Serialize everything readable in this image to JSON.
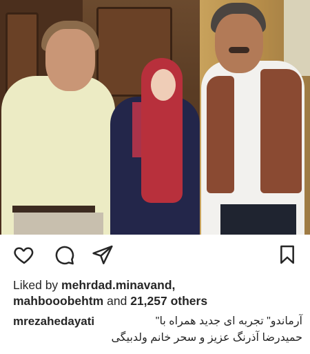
{
  "post": {
    "photo_alt": "",
    "liked_by_prefix": "Liked by ",
    "liker_1": "mehrdad.minavand,",
    "liker_2": "mahbooobehtm",
    "and_text": " and ",
    "others_text": "21,257 others",
    "caption_user": "mrezahedayati",
    "caption_line1": "آرماندو\" تجربه ای جدید همراه با\"",
    "caption_line2": "حمیدرضا آذرنگ عزیز و سحر خانم ولدبیگی"
  },
  "icons": {
    "like": "heart-outline-icon",
    "comment": "comment-bubble-icon",
    "share": "paper-plane-icon",
    "save": "bookmark-icon"
  }
}
